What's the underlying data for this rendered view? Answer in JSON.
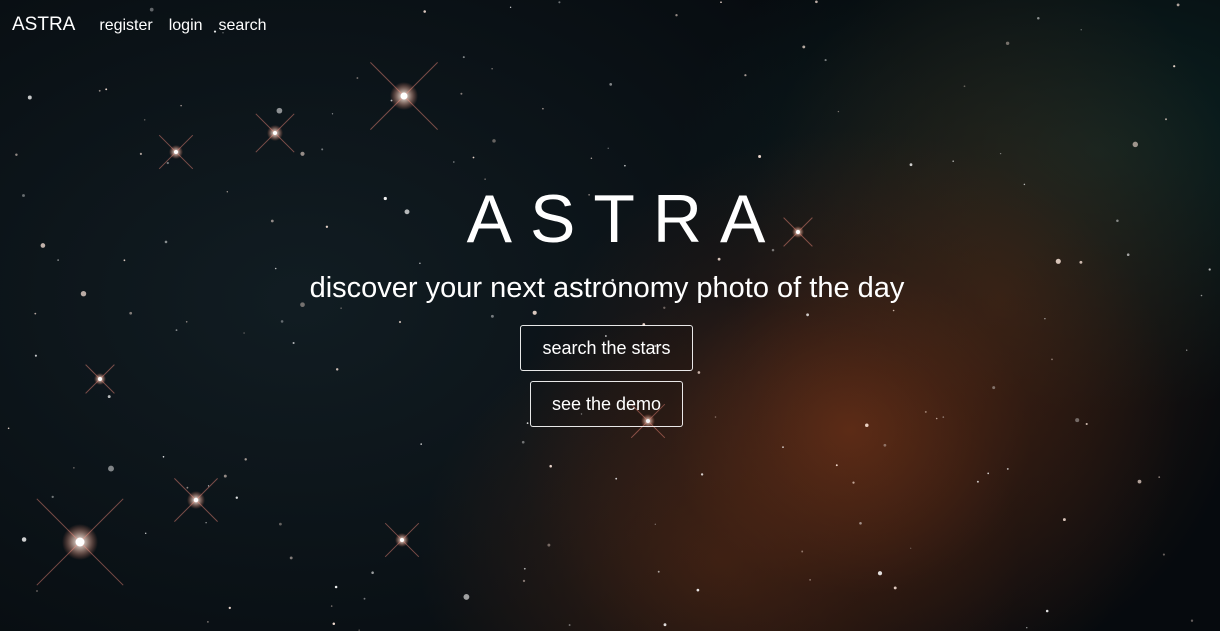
{
  "nav": {
    "brand": "ASTRA",
    "links": [
      {
        "label": "register"
      },
      {
        "label": "login"
      },
      {
        "label": "search"
      }
    ]
  },
  "hero": {
    "title": "ASTRA",
    "subtitle": "discover your next astronomy photo of the day",
    "primary_button": "search the stars",
    "secondary_button": "see the demo"
  },
  "colors": {
    "text": "#ffffff",
    "background": "#0a1014",
    "nebula": "#8c3c19"
  }
}
